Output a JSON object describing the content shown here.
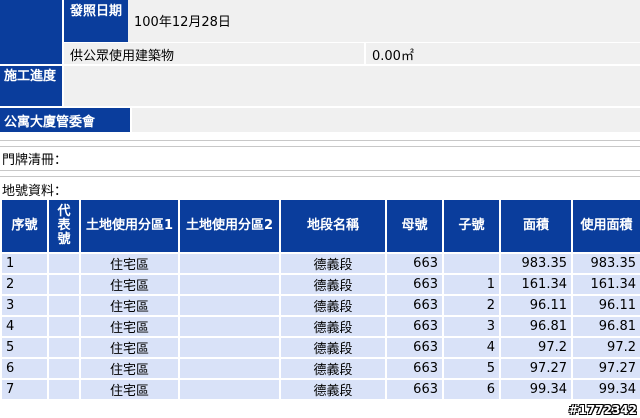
{
  "permit": {
    "issue_date_label": "發照日期",
    "issue_date_value": "100年12月28日",
    "public_area_label": "供公眾使用建築物",
    "public_area_value": "0.00㎡"
  },
  "construction_progress": {
    "label": "施工進度",
    "value": ""
  },
  "management": {
    "label": "公寓大廈管委會",
    "value": ""
  },
  "door_list": {
    "label": "門牌清冊：",
    "value": ""
  },
  "land": {
    "label": "地號資料：",
    "headers": [
      "序號",
      "代表號",
      "土地使用分區1",
      "土地使用分區2",
      "地段名稱",
      "母號",
      "子號",
      "面積",
      "使用面積"
    ],
    "rows": [
      {
        "seq": "1",
        "rep": "",
        "zone1": "住宅區",
        "zone2": "",
        "section": "德義段",
        "parent": "663",
        "child": "",
        "area": "983.35",
        "used": "983.35"
      },
      {
        "seq": "2",
        "rep": "",
        "zone1": "住宅區",
        "zone2": "",
        "section": "德義段",
        "parent": "663",
        "child": "1",
        "area": "161.34",
        "used": "161.34"
      },
      {
        "seq": "3",
        "rep": "",
        "zone1": "住宅區",
        "zone2": "",
        "section": "德義段",
        "parent": "663",
        "child": "2",
        "area": "96.11",
        "used": "96.11"
      },
      {
        "seq": "4",
        "rep": "",
        "zone1": "住宅區",
        "zone2": "",
        "section": "德義段",
        "parent": "663",
        "child": "3",
        "area": "96.81",
        "used": "96.81"
      },
      {
        "seq": "5",
        "rep": "",
        "zone1": "住宅區",
        "zone2": "",
        "section": "德義段",
        "parent": "663",
        "child": "4",
        "area": "97.2",
        "used": "97.2"
      },
      {
        "seq": "6",
        "rep": "",
        "zone1": "住宅區",
        "zone2": "",
        "section": "德義段",
        "parent": "663",
        "child": "5",
        "area": "97.27",
        "used": "97.27"
      },
      {
        "seq": "7",
        "rep": "",
        "zone1": "住宅區",
        "zone2": "",
        "section": "德義段",
        "parent": "663",
        "child": "6",
        "area": "99.34",
        "used": "99.34"
      }
    ]
  },
  "watermark": "#1772342"
}
